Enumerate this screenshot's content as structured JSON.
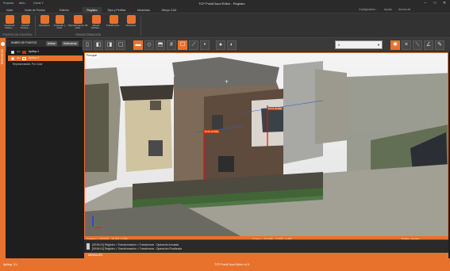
{
  "app": {
    "title": "TCP PointCloud Editor - Registro",
    "quick_access": [
      "Proyecto",
      "Abrir...",
      "Cerrar Y"
    ],
    "window_controls": [
      "−",
      "□",
      "✕"
    ],
    "user_links": [
      "Configuración...",
      "Ayuda",
      "Acerca de"
    ]
  },
  "ribbon": {
    "tabs": [
      "Inicio",
      "Nube de Puntos",
      "Edición",
      "Registro",
      "Ejes y Perfiles",
      "Modelado",
      "Dibujo CAD"
    ],
    "active_tab": "Registro",
    "buttons": [
      {
        "label": "Gestionar Nubes...",
        "icon": "cloud-manage-icon"
      },
      {
        "label": "Asociar Puntos...",
        "icon": "associate-points-icon"
      },
      {
        "label": "Desplazar",
        "icon": "move-icon"
      },
      {
        "label": "Trasladar y Girar",
        "icon": "translate-rotate-icon"
      },
      {
        "label": "Transformación 3D Libre",
        "icon": "free-transform-icon"
      },
      {
        "label": "Alinear Perfiles...",
        "icon": "align-profiles-icon"
      },
      {
        "label": "Transformar...",
        "icon": "transform-icon"
      },
      {
        "label": "Deshacer",
        "icon": "undo-icon"
      }
    ],
    "groups": [
      "PUNTOS DE CONTROL",
      "TRANSFORMACIÓN"
    ]
  },
  "viewport_toolbar": {
    "buttons": [
      "home-view-icon",
      "zoom-window-icon",
      "zoom-in-icon",
      "zoom-out-icon",
      "zoom-extents-icon",
      "zoom-previous-icon",
      "view-top-icon",
      "view-front-icon",
      "view-left-icon",
      "view-right-icon",
      "view-back-icon",
      "view-bottom-icon",
      "view-iso-icon",
      "perspective-icon",
      "grid-icon",
      "clip-box-icon",
      "measure-distance-icon",
      "measure-point-icon",
      "point-size-icon",
      "color-mode-icon",
      "render-settings-icon",
      "section-icon",
      "measure-line-icon",
      "measure-angle-icon",
      "probe-icon"
    ],
    "combo_value": "0"
  },
  "sidebar": {
    "strip_label": "PROYECTO",
    "panel_title": "NUBES DE PUNTOS",
    "pills": [
      "Activar",
      "Seleccionar"
    ],
    "clouds": [
      {
        "name": "Apiltop-1",
        "prefix": "obs",
        "color": "#e02020"
      },
      {
        "name": "Apiltop-2",
        "prefix": "obs",
        "color": "#e8a020"
      }
    ],
    "representation": "Representación: Por Color"
  },
  "viewport": {
    "label": "Principal",
    "annotations": [
      "Pt 03 (0.000)",
      "Pt 04 (0.000)"
    ]
  },
  "statusbar": {
    "camera": "Cámara = -109.825 ; -15.423 ; 6.360",
    "objective": "Objetivo = -116.336 ; -22.251 ; 1.134",
    "cursor": "Cursor = -116.406 ; -22.874 ; 4.697",
    "state1": "Estado: Inactivo",
    "state2": "Puntos: Inactivo"
  },
  "log": {
    "lines": [
      "[09:54:01] Registro > Transformación > Transformar : Operación Iniciada",
      "[09:54:01] Registro > Transformación > Transformar : Operación Finalizada"
    ]
  },
  "bottom_bar": {
    "label": "MENSAJES"
  },
  "appstatus": {
    "company": "Aplitop, S.L.",
    "center": "TCP PointCloud Editor v4.0"
  },
  "colors": {
    "accent": "#e8722c",
    "panel_bg": "#1e1e1e",
    "ribbon_bg": "#323232"
  }
}
